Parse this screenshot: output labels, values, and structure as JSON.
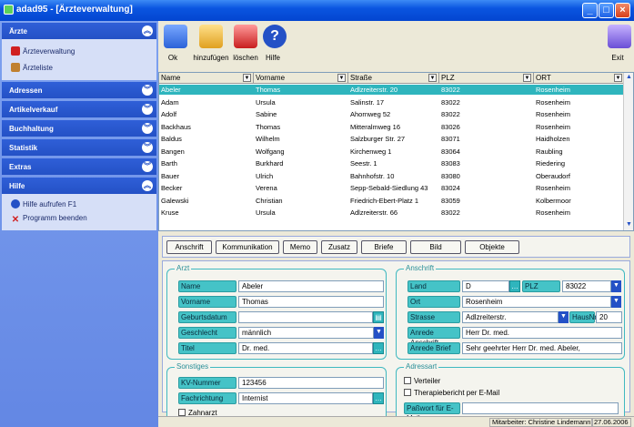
{
  "window": {
    "title": "adad95 - [Ärzteverwaltung]"
  },
  "sidebar": {
    "sections": [
      {
        "label": "Ärzte",
        "items": [
          "Ärzteverwaltung",
          "Ärzteliste"
        ]
      },
      {
        "label": "Adressen"
      },
      {
        "label": "Artikelverkauf"
      },
      {
        "label": "Buchhaltung"
      },
      {
        "label": "Statistik"
      },
      {
        "label": "Extras"
      },
      {
        "label": "Hilfe",
        "items": [
          "Hilfe aufrufen F1",
          "Programm beenden"
        ]
      }
    ]
  },
  "toolbar": {
    "ok": "Ok",
    "add": "hinzufügen",
    "delete": "löschen",
    "help": "Hilfe",
    "exit": "Exit"
  },
  "grid": {
    "columns": [
      "Name",
      "Vorname",
      "Straße",
      "PLZ",
      "ORT"
    ],
    "rows": [
      [
        "Abeler",
        "Thomas",
        "Adlzreiterstr. 20",
        "83022",
        "Rosenheim"
      ],
      [
        "Adam",
        "Ursula",
        "Salinstr. 17",
        "83022",
        "Rosenheim"
      ],
      [
        "Adolf",
        "Sabine",
        "Ahornweg 52",
        "83022",
        "Rosenheim"
      ],
      [
        "Backhaus",
        "Thomas",
        "Mitteralmweg 16",
        "83026",
        "Rosenheim"
      ],
      [
        "Baldus",
        "Wilhelm",
        "Salzburger Str. 27",
        "83071",
        "Haidholzen"
      ],
      [
        "Bangen",
        "Wolfgang",
        "Kirchenweg 1",
        "83064",
        "Raubling"
      ],
      [
        "Barth",
        "Burkhard",
        "Seestr. 1",
        "83083",
        "Riedering"
      ],
      [
        "Bauer",
        "Ulrich",
        "Bahnhofstr. 10",
        "83080",
        "Oberaudorf"
      ],
      [
        "Becker",
        "Verena",
        "Sepp-Sebald-Siedlung 43",
        "83024",
        "Rosenheim"
      ],
      [
        "Galewski",
        "Christian",
        "Friedrich-Ebert-Platz 1",
        "83059",
        "Kolbermoor"
      ],
      [
        "Kruse",
        "Ursula",
        "Adlzreiterstr. 66",
        "83022",
        "Rosenheim"
      ]
    ]
  },
  "tabs": [
    "Anschrift",
    "Kommunikation",
    "Memo",
    "Zusatz",
    "Briefe",
    "Bild",
    "Objekte"
  ],
  "arzt": {
    "title": "Arzt",
    "name_label": "Name",
    "name": "Abeler",
    "vorname_label": "Vorname",
    "vorname": "Thomas",
    "geburtsdatum_label": "Geburtsdatum",
    "geburtsdatum": "",
    "geschlecht_label": "Geschlecht",
    "geschlecht": "männlich",
    "titel_label": "Titel",
    "titel": "Dr. med."
  },
  "anschrift": {
    "title": "Anschrift",
    "land_label": "Land",
    "land": "D",
    "plz_label": "PLZ",
    "plz": "83022",
    "ort_label": "Ort",
    "ort": "Rosenheim",
    "strasse_label": "Strasse",
    "strasse": "Adlzreiterstr.",
    "hausnr_label": "HausNr",
    "hausnr": "20",
    "anrede_anschrift_label": "Anrede Anschrift",
    "anrede_anschrift": "Herr Dr. med.",
    "anrede_brief_label": "Anrede Brief",
    "anrede_brief": "Sehr geehrter Herr Dr. med. Abeler,"
  },
  "sonstiges": {
    "title": "Sonstiges",
    "kv_label": "KV-Nummer",
    "kv": "123456",
    "fach_label": "Fachrichtung",
    "fach": "Internist",
    "zahnarzt": "Zahnarzt"
  },
  "adressart": {
    "title": "Adressart",
    "verteiler": "Verteiler",
    "therapie": "Therapiebericht per E-Mail",
    "passwort_label": "Paßwort für E-Mail",
    "passwort": ""
  },
  "status": {
    "mitarbeiter": "Mitarbeiter:  Christine Lindemann",
    "date": "27.06.2006"
  }
}
